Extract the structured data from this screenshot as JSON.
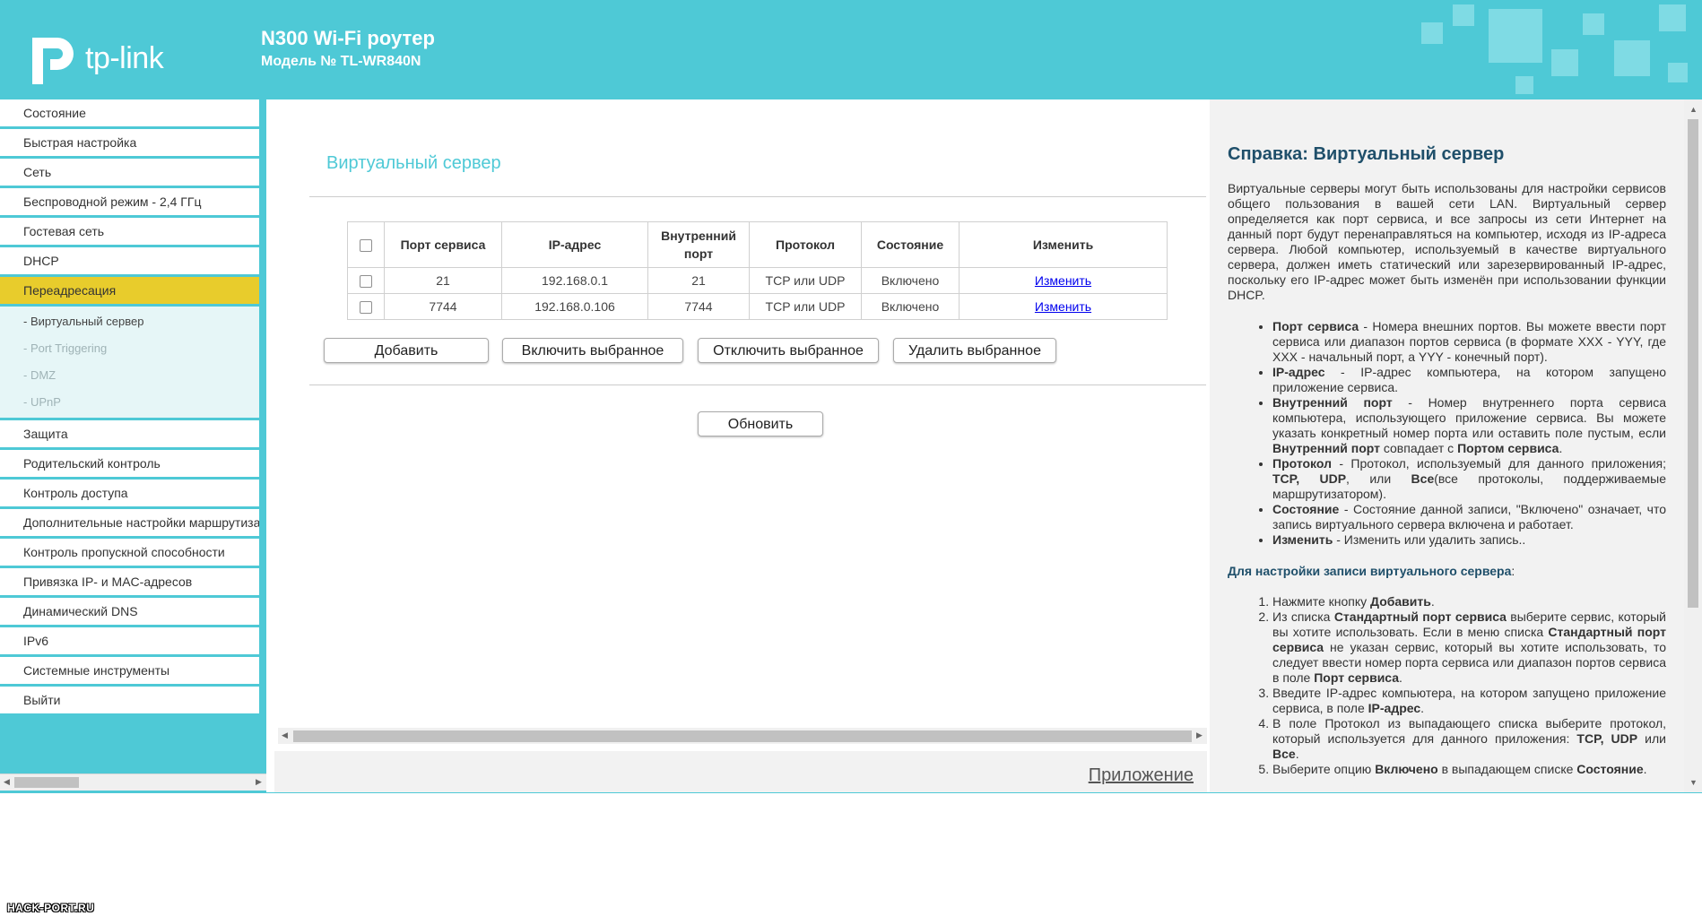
{
  "header": {
    "logo_text": "tp-link",
    "product_title": "N300 Wi-Fi роутер",
    "model_line": "Модель № TL-WR840N"
  },
  "menu": {
    "items_top": [
      "Состояние",
      "Быстрая настройка",
      "Сеть",
      "Беспроводной режим - 2,4 ГГц",
      "Гостевая сеть",
      "DHCP"
    ],
    "active_item": "Переадресация",
    "sub_items": [
      "- Виртуальный сервер",
      "- Port Triggering",
      "- DMZ",
      "- UPnP"
    ],
    "items_bottom": [
      "Защита",
      "Родительский контроль",
      "Контроль доступа",
      "Дополнительные настройки маршрутиза",
      "Контроль пропускной способности",
      "Привязка IP- и MAC-адресов",
      "Динамический DNS",
      "IPv6",
      "Системные инструменты",
      "Выйти"
    ]
  },
  "main": {
    "page_title": "Виртуальный сервер",
    "table": {
      "headers": [
        "Порт сервиса",
        "IP-адрес",
        "Внутренний порт",
        "Протокол",
        "Состояние",
        "Изменить"
      ],
      "rows": [
        {
          "port": "21",
          "ip": "192.168.0.1",
          "internal": "21",
          "protocol": "TCP или UDP",
          "status": "Включено",
          "edit": "Изменить"
        },
        {
          "port": "7744",
          "ip": "192.168.0.106",
          "internal": "7744",
          "protocol": "TCP или UDP",
          "status": "Включено",
          "edit": "Изменить"
        }
      ]
    },
    "buttons": {
      "add": "Добавить",
      "enable": "Включить выбранное",
      "disable": "Отключить выбранное",
      "delete": "Удалить выбранное",
      "refresh": "Обновить"
    },
    "app_link": "Приложение"
  },
  "help": {
    "title": "Справка: Виртуальный сервер",
    "intro": "Виртуальные серверы могут быть использованы для настройки сервисов общего пользования в вашей сети LAN. Виртуальный сервер определяется как порт сервиса, и все запросы из сети Интернет на данный порт будут перенаправляться на компьютер, исходя из IP-адреса сервера. Любой компьютер, используемый в качестве виртуального сервера, должен иметь статический или зарезервированный IP-адрес, поскольку его IP-адрес может быть изменён при использовании функции DHCP.",
    "fields": [
      {
        "term": "Порт сервиса",
        "text": " - Номера внешних портов. Вы можете ввести порт сервиса или диапазон портов сервиса (в формате XXX - YYY, где XXX - начальный порт, а YYY - конечный порт)."
      },
      {
        "term": "IP-адрес",
        "text": " - IP-адрес компьютера, на котором запущено приложение сервиса."
      },
      {
        "term": "Внутренний порт",
        "text": " - Номер внутреннего порта сервиса компьютера, использующего приложение сервиса. Вы можете указать конкретный номер порта или оставить поле пустым, если ",
        "term2": "Внутренний порт",
        "text2": " совпадает с ",
        "term3": "Портом сервиса",
        "text3": "."
      },
      {
        "term": "Протокол",
        "text": " - Протокол, используемый для данного приложения; ",
        "term2": "TCP, UDP",
        "text2": ", или ",
        "term3": "Все",
        "text3": "(все протоколы, поддерживаемые маршрутизатором)."
      },
      {
        "term": "Состояние",
        "text": " - Состояние данной записи, \"Включено\" означает, что запись виртуального сервера включена и работает."
      },
      {
        "term": "Изменить",
        "text": " - Изменить или удалить запись.."
      }
    ],
    "subhead": "Для настройки записи виртуального сервера",
    "subhead_colon": ":",
    "steps": [
      {
        "a": "Нажмите кнопку ",
        "b": "Добавить",
        "c": "."
      },
      {
        "a": "Из списка ",
        "b": "Стандартный порт сервиса",
        "c": " выберите сервис, который вы хотите использовать. Если в меню списка ",
        "d": "Стандартный порт сервиса",
        "e": " не указан сервис, который вы хотите использовать, то следует ввести номер порта сервиса или диапазон портов сервиса в поле ",
        "f": "Порт сервиса",
        "g": "."
      },
      {
        "a": "Введите IP-адрес компьютера, на котором запущено приложение сервиса, в поле ",
        "b": "IP-адрес",
        "c": "."
      },
      {
        "a": "В поле Протокол из выпадающего списка выберите протокол, который используется для данного приложения: ",
        "b": "TCP, UDP",
        "c": " или ",
        "d": "Все",
        "e": "."
      },
      {
        "a": "Выберите опцию ",
        "b": "Включено",
        "c": " в выпадающем списке ",
        "d": "Состояние",
        "e": "."
      }
    ]
  },
  "watermark": "HACK-PORT.RU",
  "colors": {
    "brand": "#4ec9d6",
    "menu_active": "#e8cc2c",
    "help_title": "#1f4f6a"
  }
}
